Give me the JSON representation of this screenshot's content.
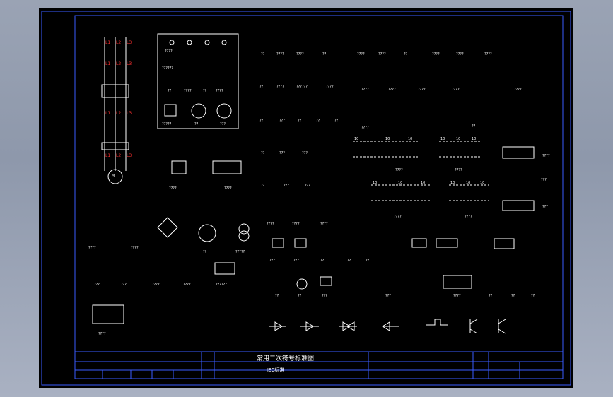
{
  "drawing": {
    "title_block": {
      "title": "常用二次符号标准图",
      "standard": "IEC标准"
    },
    "panel_labels": {
      "label_1": "????",
      "label_2": "??????",
      "label_3": "??",
      "label_4": "????",
      "label_5": "??",
      "label_6": "????",
      "label_7": "?????",
      "label_8": "??",
      "label_9": "???"
    },
    "row1": [
      "??",
      "????",
      "????",
      "??",
      "????",
      "????",
      "??",
      "????",
      "????",
      "????"
    ],
    "row2": [
      "??",
      "????",
      "??????",
      "????",
      "????",
      "????",
      "????",
      "????",
      "????"
    ],
    "row3": [
      "??",
      "???",
      "??",
      "??",
      "??",
      "????",
      "??"
    ],
    "row4": [
      "??",
      "???",
      "???"
    ],
    "row5": [
      "??",
      "???",
      "???"
    ],
    "mid_labels": {
      "bus1": "????",
      "bus2": "????",
      "bus3": "????",
      "bus4": "????",
      "right1": "????",
      "right2": "???",
      "right3": "???",
      "left_motor1": "????",
      "left_motor2": "????"
    },
    "lower_left": [
      "????",
      "????",
      "??",
      "?????"
    ],
    "lower_left2": [
      "???",
      "???",
      "????",
      "????",
      "??????"
    ],
    "lower_left3": [
      "????"
    ],
    "contact_row1": [
      "????",
      "????",
      "????"
    ],
    "contact_row2": [
      "???",
      "???",
      "??",
      "??",
      "??"
    ],
    "contact_row3": [
      "??",
      "??",
      "???",
      "???",
      "????",
      "??",
      "??",
      "??"
    ],
    "bottom_symbols": [],
    "terminal_labels": [
      "10",
      "10",
      "10",
      "10",
      "10",
      "10",
      "10",
      "10",
      "10",
      "10",
      "10",
      "10"
    ],
    "left_red_labels": [
      "L1",
      "L2",
      "L3",
      "L1",
      "L2",
      "L3",
      "L1",
      "L2",
      "L3",
      "L1",
      "L2",
      "L3"
    ],
    "colors": {
      "frame": "#3a5cff",
      "symbol": "#ffffff",
      "annotation": "#ff3030",
      "background": "#000000"
    }
  }
}
